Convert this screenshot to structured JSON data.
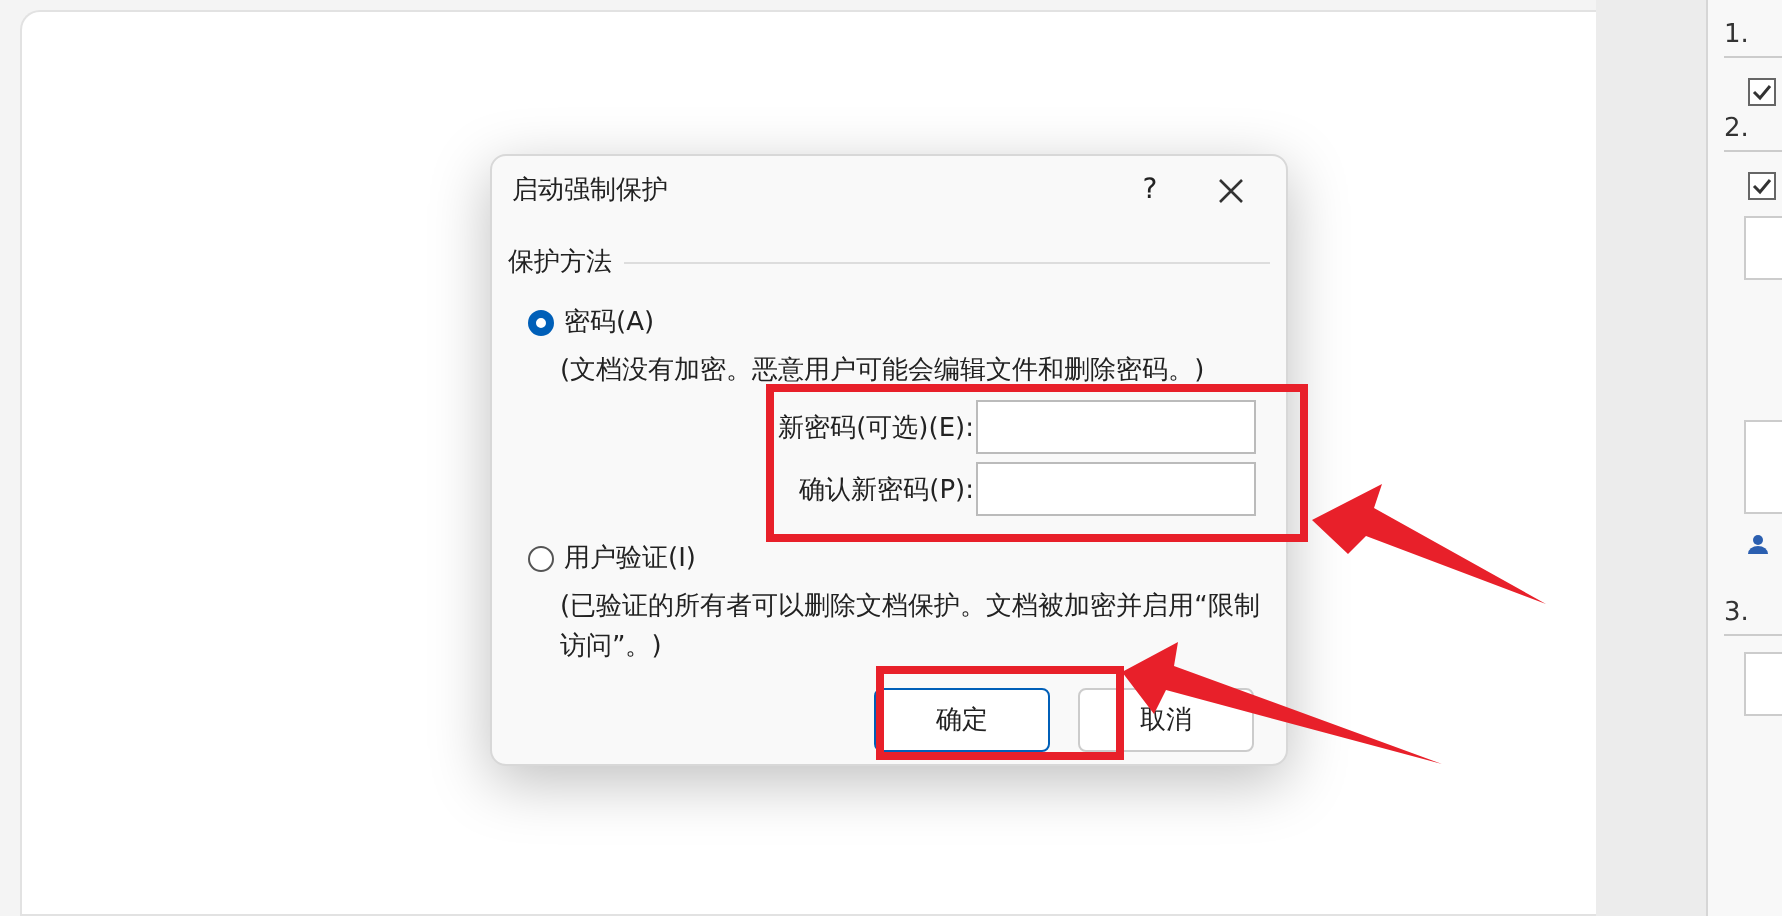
{
  "dialog": {
    "title": "启动强制保护",
    "help": "?",
    "group_label": "保护方法",
    "options": [
      {
        "label": "密码(A)",
        "selected": true,
        "description": "(文档没有加密。恶意用户可能会编辑文件和删除密码。)",
        "fields": [
          {
            "label": "新密码(可选)(E):"
          },
          {
            "label": "确认新密码(P):"
          }
        ]
      },
      {
        "label": "用户验证(I)",
        "selected": false,
        "description": "(已验证的所有者可以删除文档保护。文档被加密并启用“限制访问”。)"
      }
    ],
    "buttons": [
      {
        "label": "确定",
        "default": true
      },
      {
        "label": "取消",
        "default": false
      }
    ]
  },
  "side_panel": {
    "sections": [
      {
        "number": "1.",
        "items": [
          {
            "kind": "checkbox",
            "checked": true
          }
        ]
      },
      {
        "number": "2.",
        "items": [
          {
            "kind": "checkbox",
            "checked": true
          },
          {
            "kind": "field"
          },
          {
            "kind": "box"
          },
          {
            "kind": "person"
          }
        ]
      },
      {
        "number": "3.",
        "items": [
          {
            "kind": "field"
          }
        ]
      }
    ]
  }
}
